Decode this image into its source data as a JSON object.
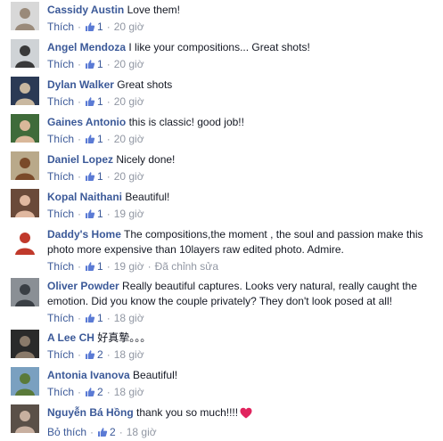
{
  "comments": [
    {
      "author": "Cassidy Austin",
      "text": "Love them!",
      "like_label": "Thích",
      "likes": "1",
      "time": "20 giờ",
      "edited": "",
      "heart": false,
      "avatar_bg": "#d8d8d8",
      "avatar_fg": "#9a8a7a"
    },
    {
      "author": "Angel Mendoza",
      "text": "I like your compositions... Great shots!",
      "like_label": "Thích",
      "likes": "1",
      "time": "20 giờ",
      "edited": "",
      "heart": false,
      "avatar_bg": "#cfd3d6",
      "avatar_fg": "#3a3a3a"
    },
    {
      "author": "Dylan Walker",
      "text": "Great shots",
      "like_label": "Thích",
      "likes": "1",
      "time": "20 giờ",
      "edited": "",
      "heart": false,
      "avatar_bg": "#2b3a55",
      "avatar_fg": "#c9b8a0"
    },
    {
      "author": "Gaines Antonio",
      "text": "this is classic! good job!!",
      "like_label": "Thích",
      "likes": "1",
      "time": "20 giờ",
      "edited": "",
      "heart": false,
      "avatar_bg": "#3f6b3a",
      "avatar_fg": "#d9b89a"
    },
    {
      "author": "Daniel Lopez",
      "text": "Nicely done!",
      "like_label": "Thích",
      "likes": "1",
      "time": "20 giờ",
      "edited": "",
      "heart": false,
      "avatar_bg": "#b9a98a",
      "avatar_fg": "#7a4a2a"
    },
    {
      "author": "Kopal Naithani",
      "text": "Beautiful!",
      "like_label": "Thích",
      "likes": "1",
      "time": "19 giờ",
      "edited": "",
      "heart": false,
      "avatar_bg": "#6a4a3a",
      "avatar_fg": "#e0b8a0"
    },
    {
      "author": "Daddy's Home",
      "text": "The compositions,the moment , the soul and passion make this photo more expensive than 10layers raw edited photo. Admire.",
      "like_label": "Thích",
      "likes": "1",
      "time": "19 giờ",
      "edited": "Đã chỉnh sửa",
      "heart": false,
      "avatar_bg": "#ffffff",
      "avatar_fg": "#c0392b"
    },
    {
      "author": "Oliver Powder",
      "text": "Really beautiful captures. Looks very natural, really caught the emotion. Did you know the couple privately? They don't look posed at all!",
      "like_label": "Thích",
      "likes": "1",
      "time": "18 giờ",
      "edited": "",
      "heart": false,
      "avatar_bg": "#8a8f95",
      "avatar_fg": "#3a3f45"
    },
    {
      "author": "A Lee CH",
      "text": "好真摯。。。",
      "like_label": "Thích",
      "likes": "2",
      "time": "18 giờ",
      "edited": "",
      "heart": false,
      "avatar_bg": "#2a2a2a",
      "avatar_fg": "#8a7a6a"
    },
    {
      "author": "Antonia Ivanova",
      "text": "Beautiful!",
      "like_label": "Thích",
      "likes": "2",
      "time": "18 giờ",
      "edited": "",
      "heart": false,
      "avatar_bg": "#7aa0c0",
      "avatar_fg": "#5a7a3a"
    },
    {
      "author": "Nguyễn Bá Hồng",
      "text": "thank you so much!!!!",
      "like_label": "Bỏ thích",
      "likes": "2",
      "time": "18 giờ",
      "edited": "",
      "heart": true,
      "avatar_bg": "#5a5048",
      "avatar_fg": "#c8b0a0"
    }
  ],
  "colors": {
    "author": "#3b5998",
    "meta": "#9197a3",
    "heart": "#e0245e"
  }
}
